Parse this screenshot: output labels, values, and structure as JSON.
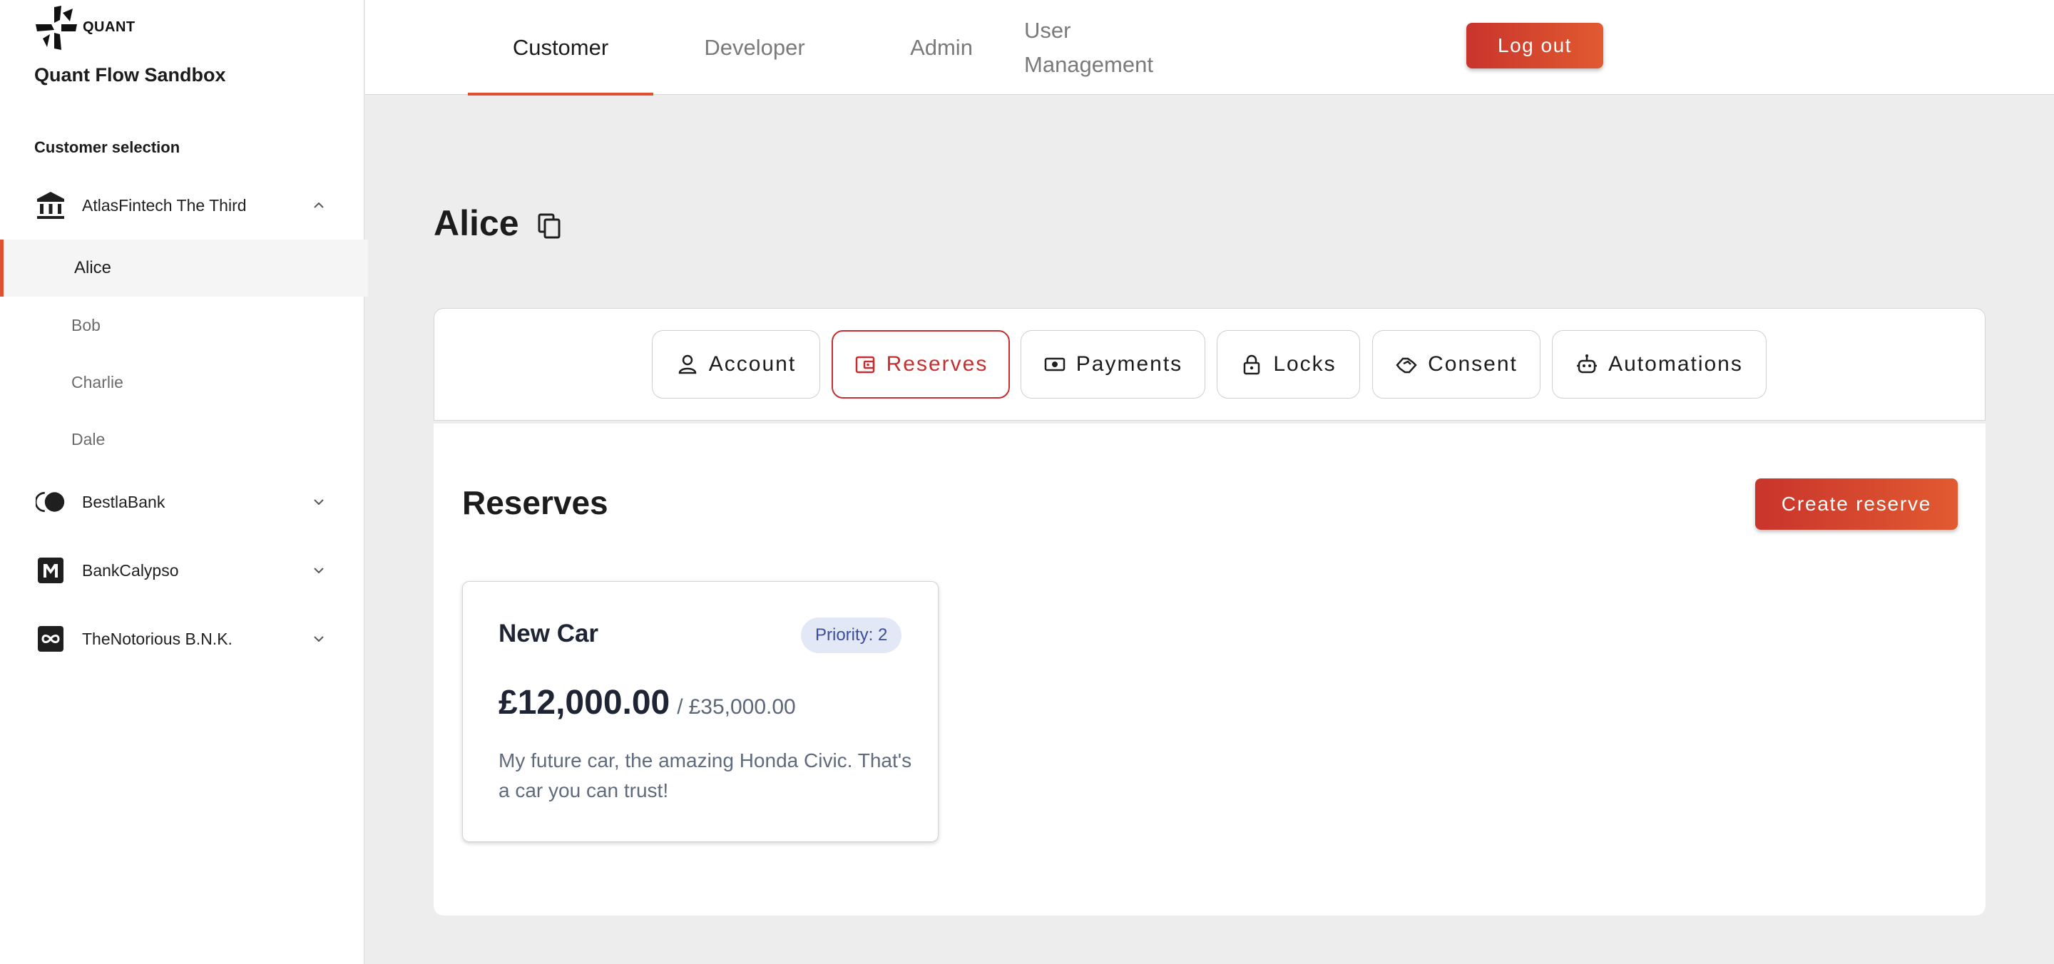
{
  "brand": {
    "logo_text": "QUANT",
    "app_title": "Quant Flow Sandbox",
    "accent_color": "#e0502f"
  },
  "sidebar": {
    "section_label": "Customer selection",
    "banks": [
      {
        "label": "AtlasFintech The Third",
        "icon": "bank-building-icon",
        "expanded": true,
        "customers": [
          {
            "label": "Alice",
            "active": true
          },
          {
            "label": "Bob",
            "active": false
          },
          {
            "label": "Charlie",
            "active": false
          },
          {
            "label": "Dale",
            "active": false
          }
        ]
      },
      {
        "label": "BestlaBank",
        "icon": "toggle-circle-icon",
        "expanded": false
      },
      {
        "label": "BankCalypso",
        "icon": "m-logo-icon",
        "expanded": false
      },
      {
        "label": "TheNotorious B.N.K.",
        "icon": "infinity-icon",
        "expanded": false
      }
    ]
  },
  "topnav": {
    "tabs": [
      {
        "label": "Customer",
        "active": true
      },
      {
        "label": "Developer",
        "active": false
      },
      {
        "label": "Admin",
        "active": false
      },
      {
        "label_line1": "User",
        "label_line2": "Management",
        "active": false
      }
    ],
    "logout_label": "Log out"
  },
  "page": {
    "title": "Alice",
    "copy_icon": "copy-icon"
  },
  "customer_tabs": [
    {
      "label": "Account",
      "icon": "person-icon",
      "active": false
    },
    {
      "label": "Reserves",
      "icon": "wallet-icon",
      "active": true
    },
    {
      "label": "Payments",
      "icon": "banknote-icon",
      "active": false
    },
    {
      "label": "Locks",
      "icon": "lock-icon",
      "active": false
    },
    {
      "label": "Consent",
      "icon": "handshake-icon",
      "active": false
    },
    {
      "label": "Automations",
      "icon": "robot-icon",
      "active": false
    }
  ],
  "reserves": {
    "section_title": "Reserves",
    "create_label": "Create reserve",
    "items": [
      {
        "name": "New Car",
        "priority": "Priority: 2",
        "current": "£12,000.00",
        "separator": "/",
        "target": "£35,000.00",
        "description": "My future car, the amazing Honda Civic. That's a car you can trust!"
      }
    ]
  }
}
